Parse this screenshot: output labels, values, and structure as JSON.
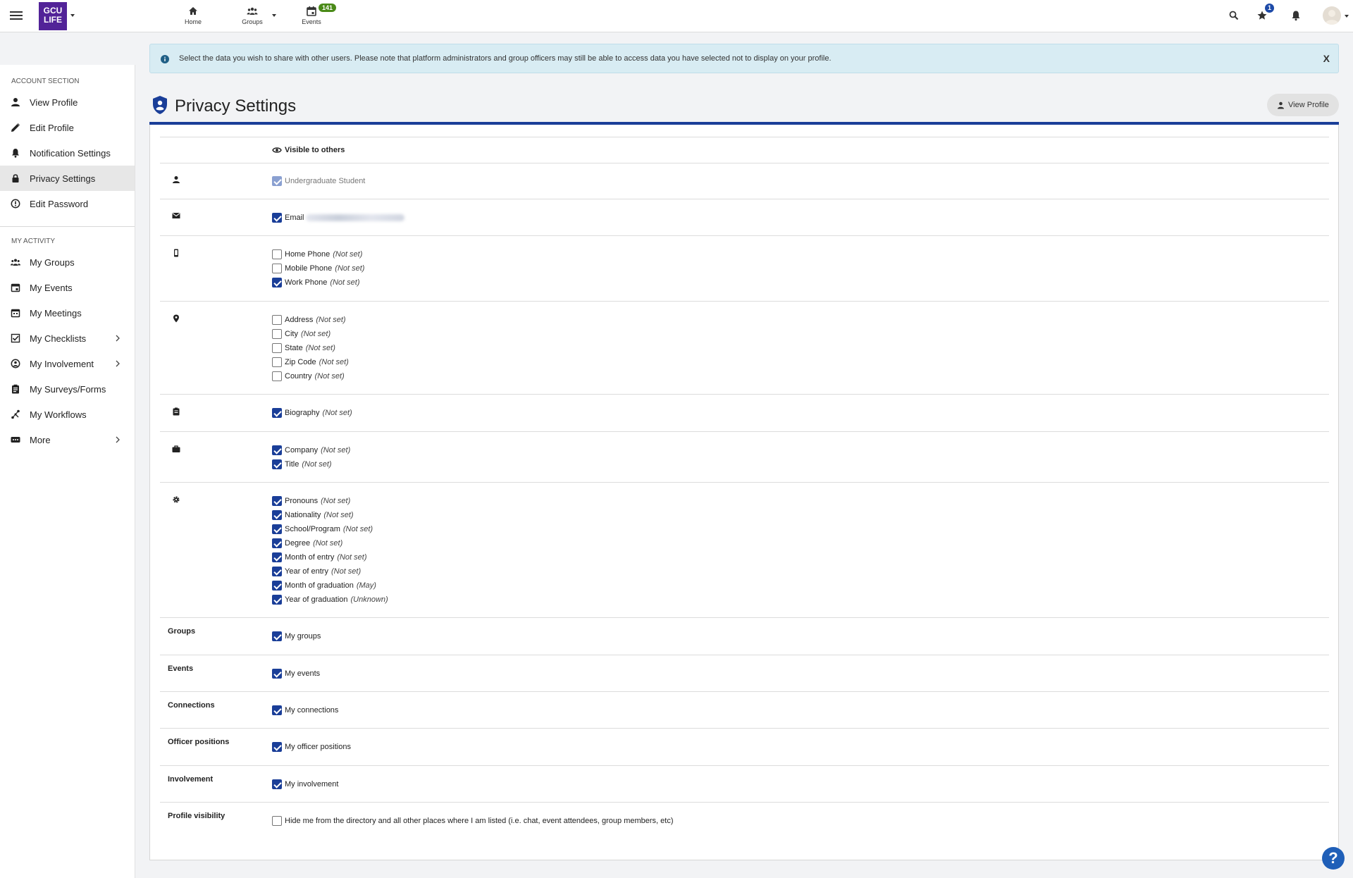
{
  "topbar": {
    "logo_text": "GCU LIFE",
    "nav": [
      {
        "label": "Home",
        "icon": "home-icon"
      },
      {
        "label": "Groups",
        "icon": "groups-icon"
      },
      {
        "label": "Events",
        "icon": "calendar-icon",
        "badge": "141"
      }
    ],
    "star_badge": "1"
  },
  "sidebar": {
    "account_heading": "ACCOUNT SECTION",
    "account_items": [
      {
        "label": "View Profile",
        "icon": "person-icon"
      },
      {
        "label": "Edit Profile",
        "icon": "pencil-icon"
      },
      {
        "label": "Notification Settings",
        "icon": "bell-icon"
      },
      {
        "label": "Privacy Settings",
        "icon": "lock-icon",
        "active": true
      },
      {
        "label": "Edit Password",
        "icon": "alert-circle-icon"
      }
    ],
    "activity_heading": "MY ACTIVITY",
    "activity_items": [
      {
        "label": "My Groups",
        "icon": "groups-icon"
      },
      {
        "label": "My Events",
        "icon": "calendar-icon"
      },
      {
        "label": "My Meetings",
        "icon": "calendar-grid-icon"
      },
      {
        "label": "My Checklists",
        "icon": "checklist-icon",
        "chevron": true
      },
      {
        "label": "My Involvement",
        "icon": "involvement-icon",
        "chevron": true
      },
      {
        "label": "My Surveys/Forms",
        "icon": "clipboard-icon"
      },
      {
        "label": "My Workflows",
        "icon": "workflow-icon"
      },
      {
        "label": "More",
        "icon": "more-icon",
        "chevron": true
      }
    ]
  },
  "banner": {
    "text": "Select the data you wish to share with other users. Please note that platform administrators and group officers may still be able to access data you have selected not to display on your profile.",
    "close_label": "X"
  },
  "header": {
    "title": "Privacy Settings",
    "view_profile_label": "View Profile"
  },
  "table": {
    "visible_header": "Visible to others",
    "student": {
      "label": "Undergraduate Student"
    },
    "email": {
      "label": "Email"
    },
    "phones": [
      {
        "label": "Home Phone",
        "note": "(Not set)"
      },
      {
        "label": "Mobile Phone",
        "note": "(Not set)"
      },
      {
        "label": "Work Phone",
        "note": "(Not set)"
      }
    ],
    "address": [
      {
        "label": "Address",
        "note": "(Not set)"
      },
      {
        "label": "City",
        "note": "(Not set)"
      },
      {
        "label": "State",
        "note": "(Not set)"
      },
      {
        "label": "Zip Code",
        "note": "(Not set)"
      },
      {
        "label": "Country",
        "note": "(Not set)"
      }
    ],
    "biography": {
      "label": "Biography",
      "note": "(Not set)"
    },
    "work": [
      {
        "label": "Company",
        "note": "(Not set)"
      },
      {
        "label": "Title",
        "note": "(Not set)"
      }
    ],
    "other": [
      {
        "label": "Pronouns",
        "note": "(Not set)"
      },
      {
        "label": "Nationality",
        "note": "(Not set)"
      },
      {
        "label": "School/Program",
        "note": "(Not set)"
      },
      {
        "label": "Degree",
        "note": "(Not set)"
      },
      {
        "label": "Month of entry",
        "note": "(Not set)"
      },
      {
        "label": "Year of entry",
        "note": "(Not set)"
      },
      {
        "label": "Month of graduation",
        "note": "(May)"
      },
      {
        "label": "Year of graduation",
        "note": "(Unknown)"
      }
    ],
    "sections": [
      {
        "title": "Groups",
        "option": "My groups"
      },
      {
        "title": "Events",
        "option": "My events"
      },
      {
        "title": "Connections",
        "option": "My connections"
      },
      {
        "title": "Officer positions",
        "option": "My officer positions"
      },
      {
        "title": "Involvement",
        "option": "My involvement"
      },
      {
        "title": "Profile visibility",
        "option": "Hide me from the directory and all other places where I am listed (i.e. chat, event attendees, group members, etc)"
      }
    ]
  },
  "help_label": "?"
}
